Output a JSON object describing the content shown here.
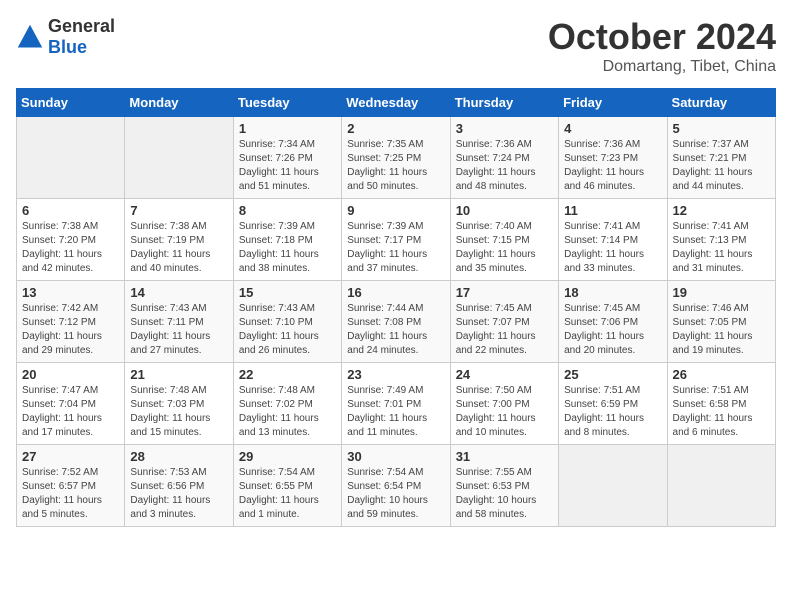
{
  "header": {
    "logo_general": "General",
    "logo_blue": "Blue",
    "month": "October 2024",
    "location": "Domartang, Tibet, China"
  },
  "weekdays": [
    "Sunday",
    "Monday",
    "Tuesday",
    "Wednesday",
    "Thursday",
    "Friday",
    "Saturday"
  ],
  "weeks": [
    [
      {
        "day": "",
        "empty": true
      },
      {
        "day": "",
        "empty": true
      },
      {
        "day": "1",
        "sunrise": "7:34 AM",
        "sunset": "7:26 PM",
        "daylight": "11 hours and 51 minutes."
      },
      {
        "day": "2",
        "sunrise": "7:35 AM",
        "sunset": "7:25 PM",
        "daylight": "11 hours and 50 minutes."
      },
      {
        "day": "3",
        "sunrise": "7:36 AM",
        "sunset": "7:24 PM",
        "daylight": "11 hours and 48 minutes."
      },
      {
        "day": "4",
        "sunrise": "7:36 AM",
        "sunset": "7:23 PM",
        "daylight": "11 hours and 46 minutes."
      },
      {
        "day": "5",
        "sunrise": "7:37 AM",
        "sunset": "7:21 PM",
        "daylight": "11 hours and 44 minutes."
      }
    ],
    [
      {
        "day": "6",
        "sunrise": "7:38 AM",
        "sunset": "7:20 PM",
        "daylight": "11 hours and 42 minutes."
      },
      {
        "day": "7",
        "sunrise": "7:38 AM",
        "sunset": "7:19 PM",
        "daylight": "11 hours and 40 minutes."
      },
      {
        "day": "8",
        "sunrise": "7:39 AM",
        "sunset": "7:18 PM",
        "daylight": "11 hours and 38 minutes."
      },
      {
        "day": "9",
        "sunrise": "7:39 AM",
        "sunset": "7:17 PM",
        "daylight": "11 hours and 37 minutes."
      },
      {
        "day": "10",
        "sunrise": "7:40 AM",
        "sunset": "7:15 PM",
        "daylight": "11 hours and 35 minutes."
      },
      {
        "day": "11",
        "sunrise": "7:41 AM",
        "sunset": "7:14 PM",
        "daylight": "11 hours and 33 minutes."
      },
      {
        "day": "12",
        "sunrise": "7:41 AM",
        "sunset": "7:13 PM",
        "daylight": "11 hours and 31 minutes."
      }
    ],
    [
      {
        "day": "13",
        "sunrise": "7:42 AM",
        "sunset": "7:12 PM",
        "daylight": "11 hours and 29 minutes."
      },
      {
        "day": "14",
        "sunrise": "7:43 AM",
        "sunset": "7:11 PM",
        "daylight": "11 hours and 27 minutes."
      },
      {
        "day": "15",
        "sunrise": "7:43 AM",
        "sunset": "7:10 PM",
        "daylight": "11 hours and 26 minutes."
      },
      {
        "day": "16",
        "sunrise": "7:44 AM",
        "sunset": "7:08 PM",
        "daylight": "11 hours and 24 minutes."
      },
      {
        "day": "17",
        "sunrise": "7:45 AM",
        "sunset": "7:07 PM",
        "daylight": "11 hours and 22 minutes."
      },
      {
        "day": "18",
        "sunrise": "7:45 AM",
        "sunset": "7:06 PM",
        "daylight": "11 hours and 20 minutes."
      },
      {
        "day": "19",
        "sunrise": "7:46 AM",
        "sunset": "7:05 PM",
        "daylight": "11 hours and 19 minutes."
      }
    ],
    [
      {
        "day": "20",
        "sunrise": "7:47 AM",
        "sunset": "7:04 PM",
        "daylight": "11 hours and 17 minutes."
      },
      {
        "day": "21",
        "sunrise": "7:48 AM",
        "sunset": "7:03 PM",
        "daylight": "11 hours and 15 minutes."
      },
      {
        "day": "22",
        "sunrise": "7:48 AM",
        "sunset": "7:02 PM",
        "daylight": "11 hours and 13 minutes."
      },
      {
        "day": "23",
        "sunrise": "7:49 AM",
        "sunset": "7:01 PM",
        "daylight": "11 hours and 11 minutes."
      },
      {
        "day": "24",
        "sunrise": "7:50 AM",
        "sunset": "7:00 PM",
        "daylight": "11 hours and 10 minutes."
      },
      {
        "day": "25",
        "sunrise": "7:51 AM",
        "sunset": "6:59 PM",
        "daylight": "11 hours and 8 minutes."
      },
      {
        "day": "26",
        "sunrise": "7:51 AM",
        "sunset": "6:58 PM",
        "daylight": "11 hours and 6 minutes."
      }
    ],
    [
      {
        "day": "27",
        "sunrise": "7:52 AM",
        "sunset": "6:57 PM",
        "daylight": "11 hours and 5 minutes."
      },
      {
        "day": "28",
        "sunrise": "7:53 AM",
        "sunset": "6:56 PM",
        "daylight": "11 hours and 3 minutes."
      },
      {
        "day": "29",
        "sunrise": "7:54 AM",
        "sunset": "6:55 PM",
        "daylight": "11 hours and 1 minute."
      },
      {
        "day": "30",
        "sunrise": "7:54 AM",
        "sunset": "6:54 PM",
        "daylight": "10 hours and 59 minutes."
      },
      {
        "day": "31",
        "sunrise": "7:55 AM",
        "sunset": "6:53 PM",
        "daylight": "10 hours and 58 minutes."
      },
      {
        "day": "",
        "empty": true
      },
      {
        "day": "",
        "empty": true
      }
    ]
  ]
}
